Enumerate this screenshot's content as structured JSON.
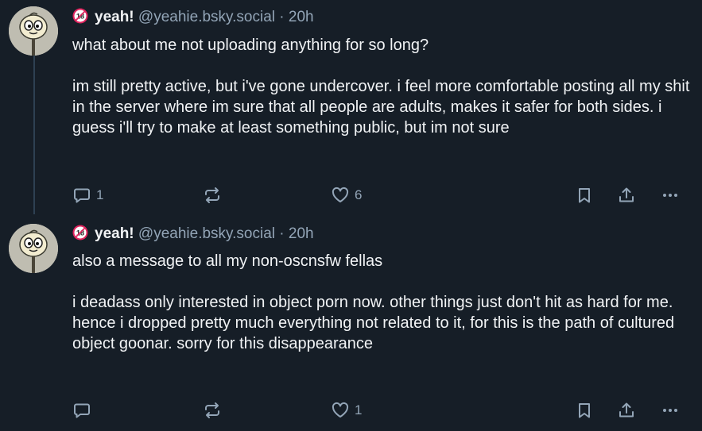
{
  "posts": [
    {
      "display_name": "yeah!",
      "handle": "@yeahie.bsky.social",
      "separator": "·",
      "time": "20h",
      "paragraphs": [
        "what about me not uploading anything for so long?",
        "im still pretty active, but i've gone undercover. i feel more comfortable posting all my shit in the server where im sure that all people are adults, makes it safer for both sides. i guess i'll try to make at least something public, but im not sure"
      ],
      "reply_count": "1",
      "repost_count": "",
      "like_count": "6"
    },
    {
      "display_name": "yeah!",
      "handle": "@yeahie.bsky.social",
      "separator": "·",
      "time": "20h",
      "paragraphs": [
        "also a message to all my non-oscnsfw fellas",
        "i deadass only interested in object porn now. other things just don't hit as hard for me. hence i dropped pretty much everything not related to it, for this is the path of cultured object goonar. sorry for this disappearance"
      ],
      "reply_count": "",
      "repost_count": "",
      "like_count": "1"
    }
  ],
  "icons": {
    "badge": "18-plus-icon",
    "reply": "reply-icon",
    "repost": "repost-icon",
    "like": "heart-icon",
    "bookmark": "bookmark-icon",
    "share": "share-icon",
    "more": "more-icon"
  },
  "colors": {
    "background": "#161e27",
    "text": "#f1f3f5",
    "muted": "#93a5b7",
    "thread_line": "#2e4052",
    "badge_red": "#e0245e"
  }
}
